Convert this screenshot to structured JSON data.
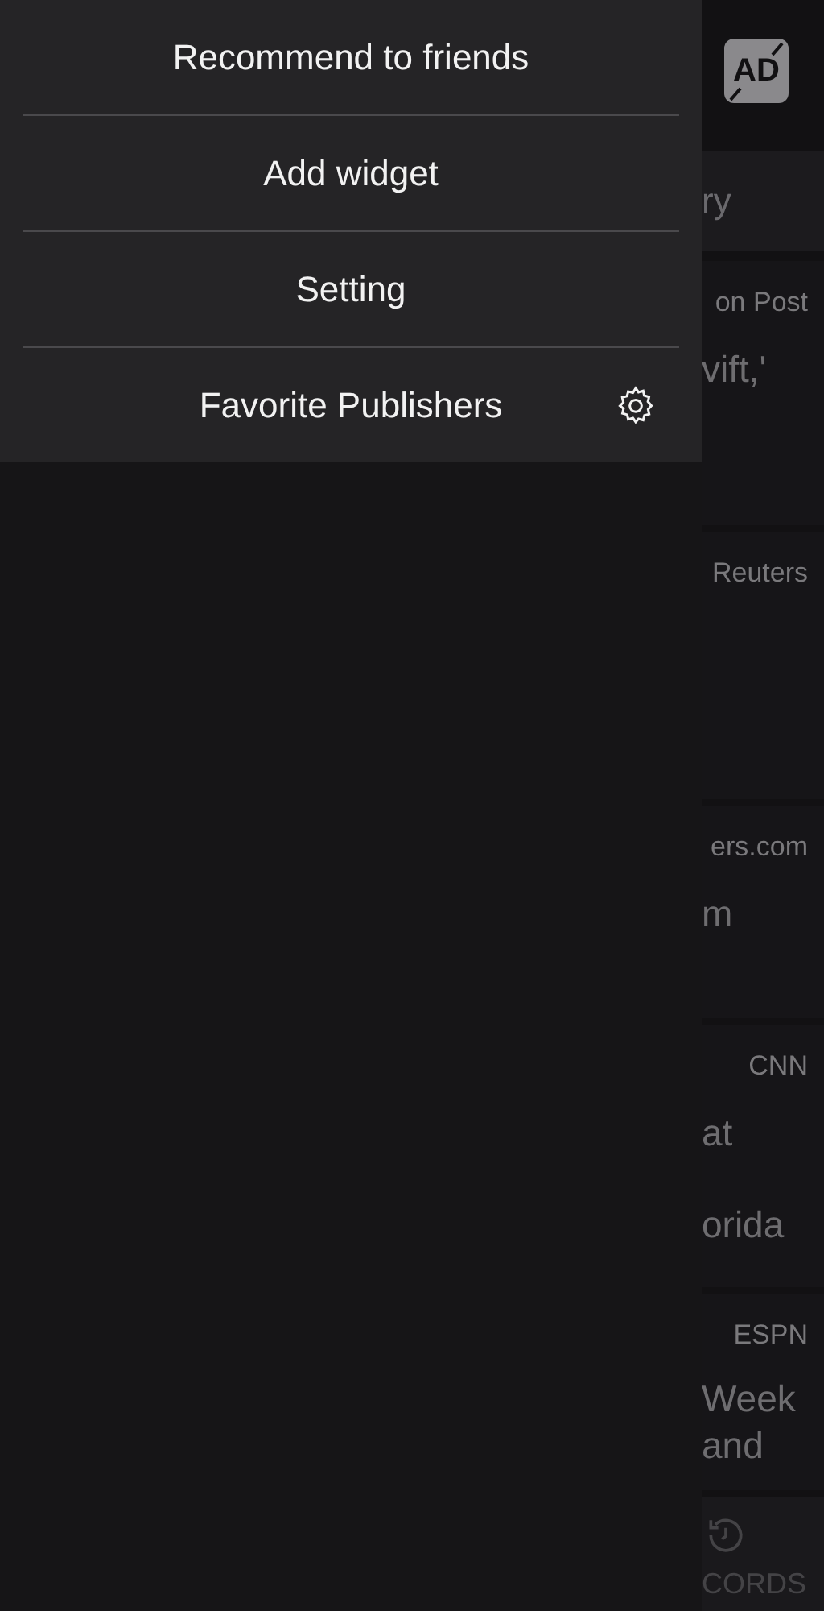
{
  "menu": [
    {
      "label": "Recommend to friends",
      "kind": "plain"
    },
    {
      "label": "Add widget",
      "kind": "plain"
    },
    {
      "label": "Setting",
      "kind": "plain"
    },
    {
      "label": "Favorite Publishers",
      "kind": "with-settings"
    }
  ],
  "background": {
    "ad_badge": "AD",
    "search": {
      "placeholder": "ry"
    },
    "cards": [
      {
        "source": "on Post",
        "headline": [
          "vift,'"
        ]
      },
      {
        "source": "Reuters"
      },
      {
        "source": "ers.com",
        "headline": [
          "m"
        ]
      },
      {
        "source": "CNN",
        "headline": [
          "at",
          "orida"
        ]
      },
      {
        "source": "ESPN",
        "headline": [
          "Week",
          "and"
        ]
      }
    ],
    "nav_label": "CORDS"
  }
}
